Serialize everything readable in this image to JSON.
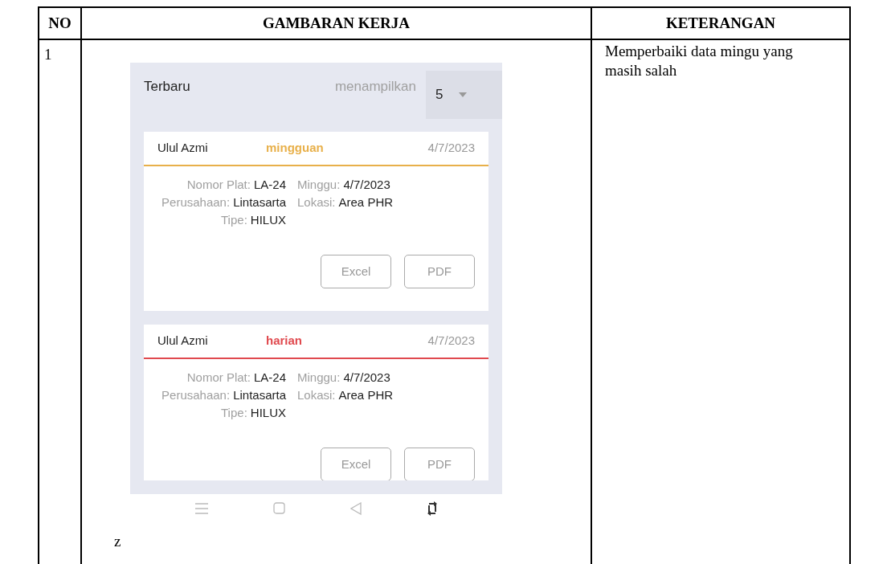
{
  "table": {
    "columns": [
      "NO",
      "GAMBARAN KERJA",
      "KETERANGAN"
    ],
    "rows": [
      {
        "no": "1",
        "screen": {
          "title": "Terbaru",
          "show_label": "menampilkan",
          "show_value": "5",
          "cards": [
            {
              "name": "Ulul Azmi",
              "type": "mingguan",
              "color": "#e8b04a",
              "date": "4/7/2023",
              "fields": [
                [
                  {
                    "label": "Nomor Plat:",
                    "value": "LA-24"
                  },
                  {
                    "label": "Minggu:",
                    "value": "4/7/2023"
                  }
                ],
                [
                  {
                    "label": "Perusahaan:",
                    "value": "Lintasarta"
                  },
                  {
                    "label": "Lokasi:",
                    "value": "Area PHR"
                  }
                ],
                [
                  {
                    "label": "Tipe:",
                    "value": "HILUX"
                  }
                ]
              ],
              "buttons": [
                "Excel",
                "PDF"
              ]
            },
            {
              "name": "Ulul Azmi",
              "type": "harian",
              "color": "#e0494e",
              "date": "4/7/2023",
              "fields": [
                [
                  {
                    "label": "Nomor Plat:",
                    "value": "LA-24"
                  },
                  {
                    "label": "Minggu:",
                    "value": "4/7/2023"
                  }
                ],
                [
                  {
                    "label": "Perusahaan:",
                    "value": "Lintasarta"
                  },
                  {
                    "label": "Lokasi:",
                    "value": "Area PHR"
                  }
                ],
                [
                  {
                    "label": "Tipe:",
                    "value": "HILUX"
                  }
                ]
              ],
              "buttons": [
                "Excel",
                "PDF"
              ]
            }
          ]
        },
        "note": "z",
        "description": "Memperbaiki data mingu yang masih salah"
      }
    ]
  }
}
